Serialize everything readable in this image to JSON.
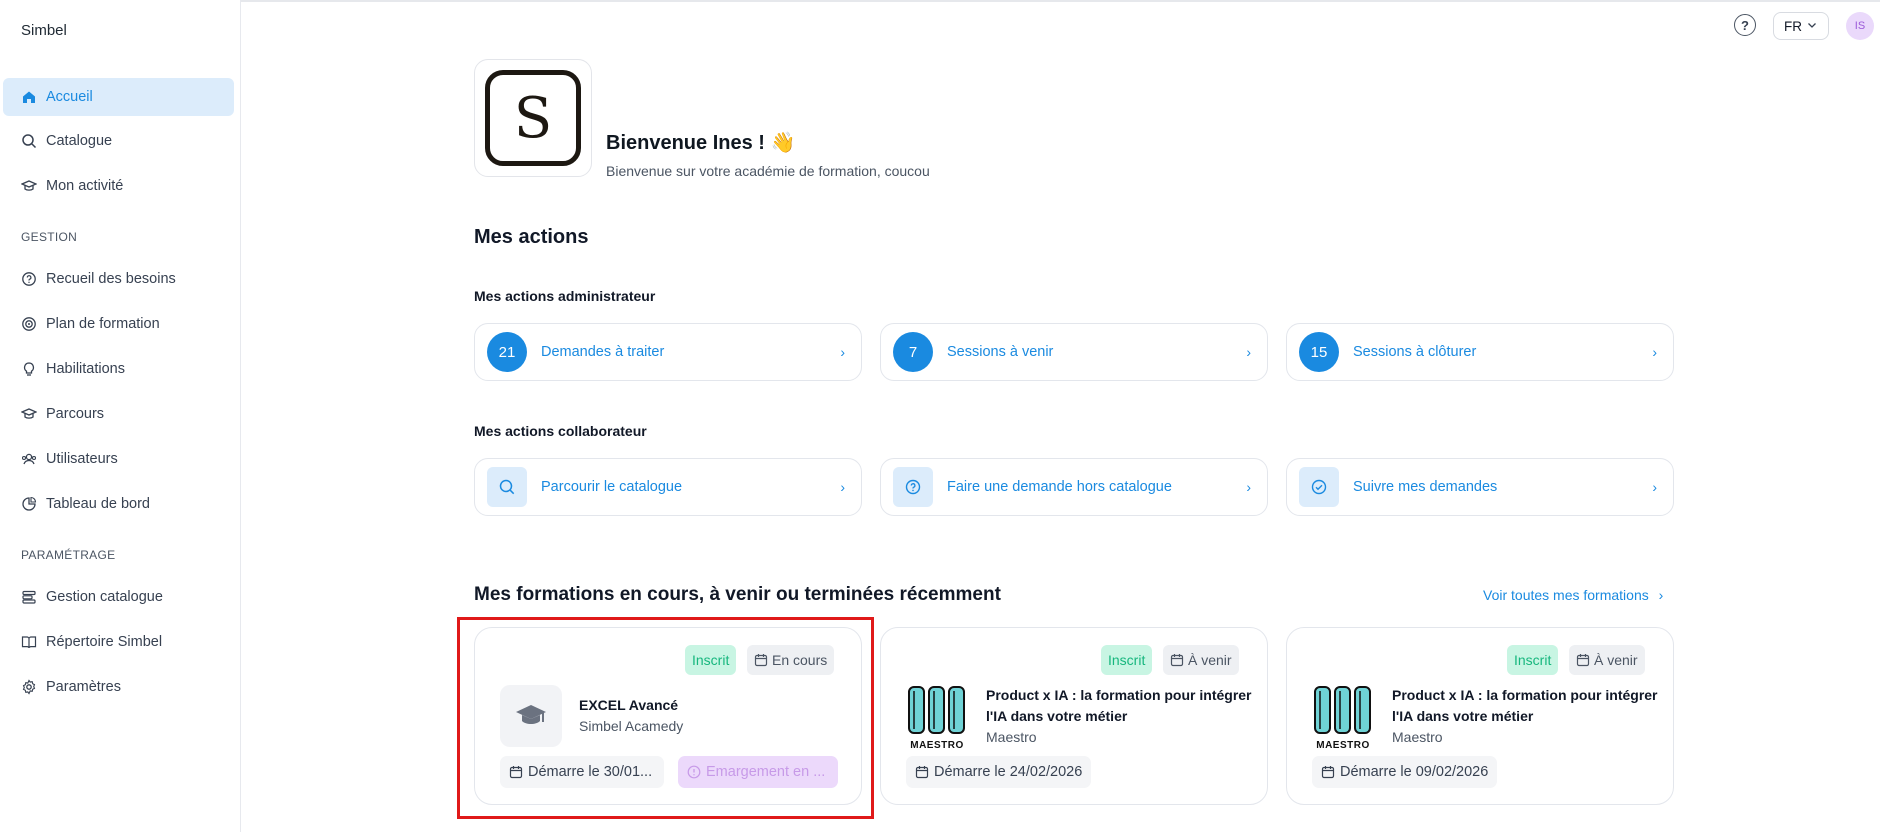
{
  "app": {
    "brand": "Simbel"
  },
  "sidebar": {
    "main": [
      {
        "label": "Accueil",
        "icon": "home-icon",
        "active": true
      },
      {
        "label": "Catalogue",
        "icon": "search-icon"
      },
      {
        "label": "Mon activité",
        "icon": "graduation-cap-icon"
      }
    ],
    "gestion_label": "GESTION",
    "gestion": [
      {
        "label": "Recueil des besoins",
        "icon": "question-bubble-icon"
      },
      {
        "label": "Plan de formation",
        "icon": "target-icon"
      },
      {
        "label": "Habilitations",
        "icon": "lightbulb-icon"
      },
      {
        "label": "Parcours",
        "icon": "graduation-cap-icon"
      },
      {
        "label": "Utilisateurs",
        "icon": "users-icon"
      },
      {
        "label": "Tableau de bord",
        "icon": "pie-chart-icon"
      }
    ],
    "param_label": "PARAMÉTRAGE",
    "param": [
      {
        "label": "Gestion catalogue",
        "icon": "layers-icon"
      },
      {
        "label": "Répertoire Simbel",
        "icon": "book-icon"
      },
      {
        "label": "Paramètres",
        "icon": "gear-icon"
      }
    ]
  },
  "topbar": {
    "help": "?",
    "language": "FR",
    "avatar_initials": "IS"
  },
  "header": {
    "logo_letter": "S",
    "title": "Bienvenue Ines ! 👋",
    "subtitle": "Bienvenue sur votre académie de formation, coucou"
  },
  "actions": {
    "title": "Mes actions",
    "admin_title": "Mes actions administrateur",
    "admin": [
      {
        "count": "21",
        "label": "Demandes à traiter"
      },
      {
        "count": "7",
        "label": "Sessions à venir"
      },
      {
        "count": "15",
        "label": "Sessions à clôturer"
      }
    ],
    "collab_title": "Mes actions collaborateur",
    "collab": [
      {
        "label": "Parcourir le catalogue",
        "icon": "search-icon"
      },
      {
        "label": "Faire une demande hors catalogue",
        "icon": "question-bubble-icon"
      },
      {
        "label": "Suivre mes demandes",
        "icon": "check-circle-icon"
      }
    ]
  },
  "trainings": {
    "title": "Mes formations en cours, à venir ou terminées récemment",
    "see_all": "Voir toutes mes formations",
    "cards": [
      {
        "status": "Inscrit",
        "phase": "En cours",
        "title": "EXCEL Avancé",
        "org": "Simbel Acamedy",
        "date": "Démarre le 30/01...",
        "extra": "Emargement en ...",
        "thumb": "graduation-cap-icon"
      },
      {
        "status": "Inscrit",
        "phase": "À venir",
        "title_line1": "Product x IA : la formation pour intégrer",
        "title_line2": "l'IA dans votre métier",
        "org": "Maestro",
        "date": "Démarre le 24/02/2026",
        "thumb_text": "MAESTRO"
      },
      {
        "status": "Inscrit",
        "phase": "À venir",
        "title_line1": "Product x IA : la formation pour intégrer",
        "title_line2": "l'IA dans votre métier",
        "org": "Maestro",
        "date": "Démarre le 09/02/2026",
        "thumb_text": "MAESTRO"
      }
    ]
  },
  "colors": {
    "accent": "#1a8ae0",
    "active_bg": "#dcecfb",
    "green": "#17b77e",
    "highlight": "#e01919"
  }
}
